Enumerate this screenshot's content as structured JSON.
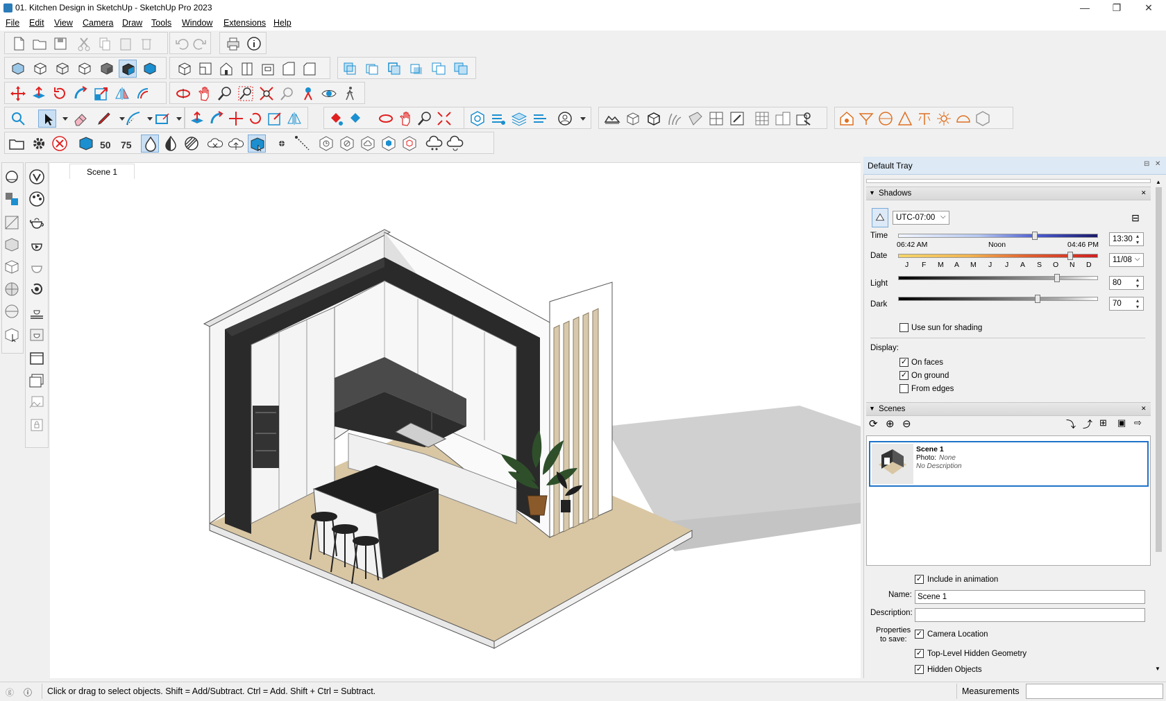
{
  "window": {
    "title": "01. Kitchen Design in SketchUp - SketchUp Pro 2023",
    "minimize": "—",
    "restore": "❐",
    "close": "✕"
  },
  "menu": {
    "items": [
      "File",
      "Edit",
      "View",
      "Camera",
      "Draw",
      "Tools",
      "Window",
      "Extensions",
      "Help"
    ]
  },
  "scene_tab": {
    "label": "Scene 1"
  },
  "tray": {
    "title": "Default Tray",
    "shadows": {
      "header": "Shadows",
      "timezone": "UTC-07:00",
      "time_label": "Time",
      "time_start": "06:42 AM",
      "time_mid": "Noon",
      "time_end": "04:46 PM",
      "time_value": "13:30",
      "date_label": "Date",
      "months": [
        "J",
        "F",
        "M",
        "A",
        "M",
        "J",
        "J",
        "A",
        "S",
        "O",
        "N",
        "D"
      ],
      "date_value": "11/08",
      "light_label": "Light",
      "light_value": "80",
      "dark_label": "Dark",
      "dark_value": "70",
      "use_sun": "Use sun for shading",
      "display_label": "Display:",
      "on_faces": "On faces",
      "on_ground": "On ground",
      "from_edges": "From edges"
    },
    "scenes": {
      "header": "Scenes",
      "item_name": "Scene 1",
      "item_photo_label": "Photo:",
      "item_photo_value": "None",
      "item_description": "No Description",
      "include_anim": "Include in animation",
      "name_label": "Name:",
      "name_value": "Scene 1",
      "desc_label": "Description:",
      "props_label_1": "Properties",
      "props_label_2": "to save:",
      "camera_location": "Camera Location",
      "top_level_hidden": "Top-Level Hidden Geometry",
      "hidden_objects": "Hidden Objects"
    }
  },
  "status": {
    "hint": "Click or drag to select objects. Shift = Add/Subtract. Ctrl = Add. Shift + Ctrl = Subtract.",
    "measurements_label": "Measurements"
  },
  "colors": {
    "accent": "#1e73c8",
    "tray_title": "#dde9f5",
    "red_tool": "#e02020",
    "blue_tool": "#1b8fd0"
  }
}
